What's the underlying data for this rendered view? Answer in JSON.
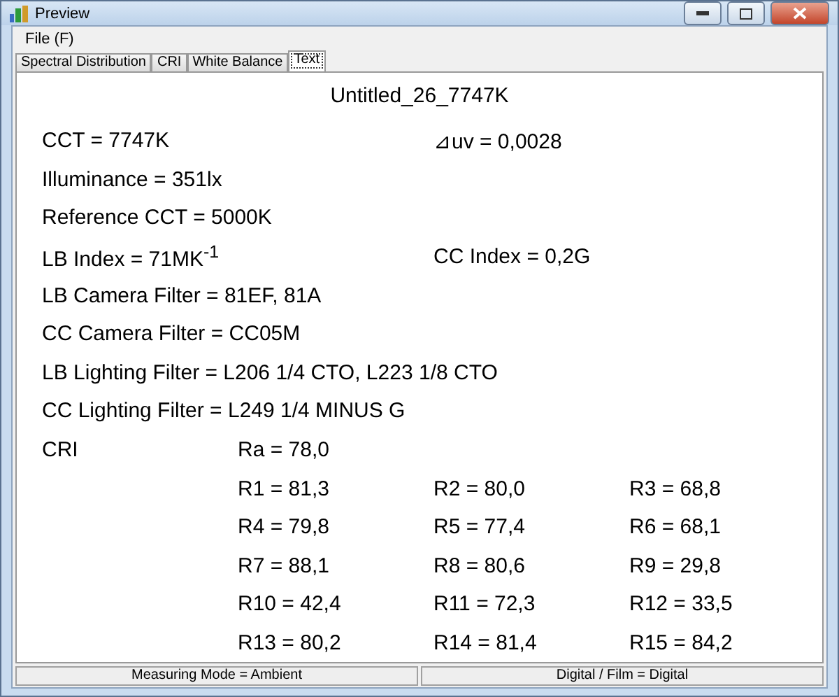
{
  "window": {
    "title": "Preview"
  },
  "menu": [
    "File (F)"
  ],
  "tabs": [
    {
      "label": "Spectral Distribution",
      "selected": false
    },
    {
      "label": "CRI",
      "selected": false
    },
    {
      "label": "White Balance",
      "selected": false
    },
    {
      "label": "Text",
      "selected": true
    }
  ],
  "report": {
    "title": "Untitled_26_7747K",
    "lines": [
      {
        "left": "CCT = 7747K",
        "right": "⊿uv = 0,0028"
      },
      {
        "left": "Illuminance = 351lx"
      },
      {
        "left": "Reference CCT = 5000K"
      },
      {
        "left": "LB Index = 71MK$^{-1}$",
        "right": "CC Index = 0,2G"
      },
      {
        "left": "LB Camera Filter = 81EF, 81A"
      },
      {
        "left": "CC Camera Filter = CC05M"
      },
      {
        "left": "LB Lighting Filter = L206 1/4 CTO, L223 1/8 CTO"
      },
      {
        "left": "CC Lighting Filter = L249 1/4 MINUS G"
      }
    ],
    "cri": {
      "label": "CRI",
      "ra": "Ra = 78,0",
      "values": [
        "R1 = 81,3",
        "R2 = 80,0",
        "R3 = 68,8",
        "R4 = 79,8",
        "R5 = 77,4",
        "R6 = 68,1",
        "R7 = 88,1",
        "R8 = 80,6",
        "R9 = 29,8",
        "R10 = 42,4",
        "R11 = 72,3",
        "R12 = 33,5",
        "R13 = 80,2",
        "R14 = 81,4",
        "R15 = 84,2"
      ]
    }
  },
  "status_bar": [
    "Measuring Mode = Ambient",
    "Digital / Film = Digital"
  ]
}
